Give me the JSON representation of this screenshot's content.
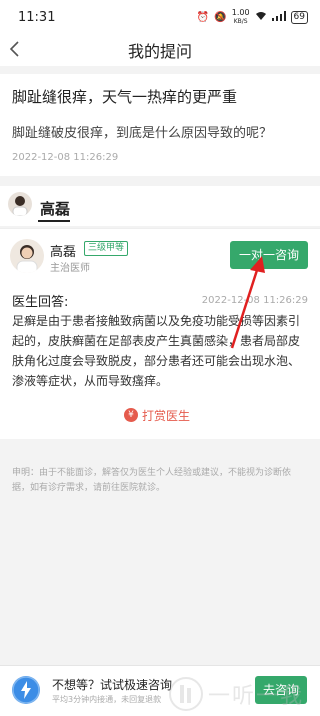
{
  "status_bar": {
    "time": "11:31",
    "net_speed": "1.00",
    "net_unit": "KB/S",
    "battery": "69"
  },
  "nav": {
    "back_icon": "chevron-left-icon",
    "title": "我的提问"
  },
  "question": {
    "title": "脚趾缝很痒，天气一热痒的更严重",
    "description": "脚趾缝破皮很痒，到底是什么原因导致的呢？",
    "time": "2022-12-08 11:26:29"
  },
  "doctor_tab": {
    "name": "高磊"
  },
  "answer": {
    "doctor_name": "高磊",
    "hospital_level": "三级甲等",
    "doctor_title": "主治医师",
    "consult_button": "一对一咨询",
    "reply_label": "医生回答:",
    "reply_time": "2022-12-08 11:26:29",
    "reply_text": "足癣是由于患者接触致病菌以及免疫功能受损等因素引起的，皮肤癣菌在足部表皮产生真菌感染，患者局部皮肤角化过度会导致脱皮，部分患者还可能会出现水泡、渗液等症状，从而导致瘙痒。",
    "tip_button": "打赏医生"
  },
  "disclaimer": "申明：由于不能面诊，解答仅为医生个人经验或建议，不能视为诊断依据，如有诊疗需求，请前往医院就诊。",
  "bottom_bar": {
    "title": "不想等？试试极速咨询",
    "subtitle": "平均3分钟内接通，未回复退款",
    "button": "去咨询"
  },
  "colors": {
    "accent": "#35a86b",
    "tip": "#e55b4d",
    "arrow": "#e02020"
  }
}
